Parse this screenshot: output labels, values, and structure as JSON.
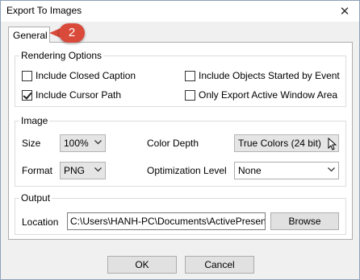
{
  "window": {
    "title": "Export To Images",
    "close_glyph": "✕"
  },
  "tabs": [
    {
      "label": "General"
    }
  ],
  "step_badge": "2",
  "rendering": {
    "title": "Rendering Options",
    "options": [
      {
        "label": "Include Closed Caption",
        "checked": false
      },
      {
        "label": "Include Objects Started by Event",
        "checked": false
      },
      {
        "label": "Include Cursor Path",
        "checked": true
      },
      {
        "label": "Only Export Active Window Area",
        "checked": false
      }
    ]
  },
  "image": {
    "title": "Image",
    "size_label": "Size",
    "size_value": "100%",
    "format_label": "Format",
    "format_value": "PNG",
    "color_depth_label": "Color Depth",
    "color_depth_value": "True Colors (24 bit)",
    "optimization_label": "Optimization Level",
    "optimization_value": "None"
  },
  "output": {
    "title": "Output",
    "location_label": "Location",
    "location_value": "C:\\Users\\HANH-PC\\Documents\\ActivePresen",
    "browse_label": "Browse"
  },
  "footer": {
    "ok_label": "OK",
    "cancel_label": "Cancel"
  },
  "colors": {
    "badge": "#d94a3a",
    "dialog_bg": "#f0f0f0"
  }
}
